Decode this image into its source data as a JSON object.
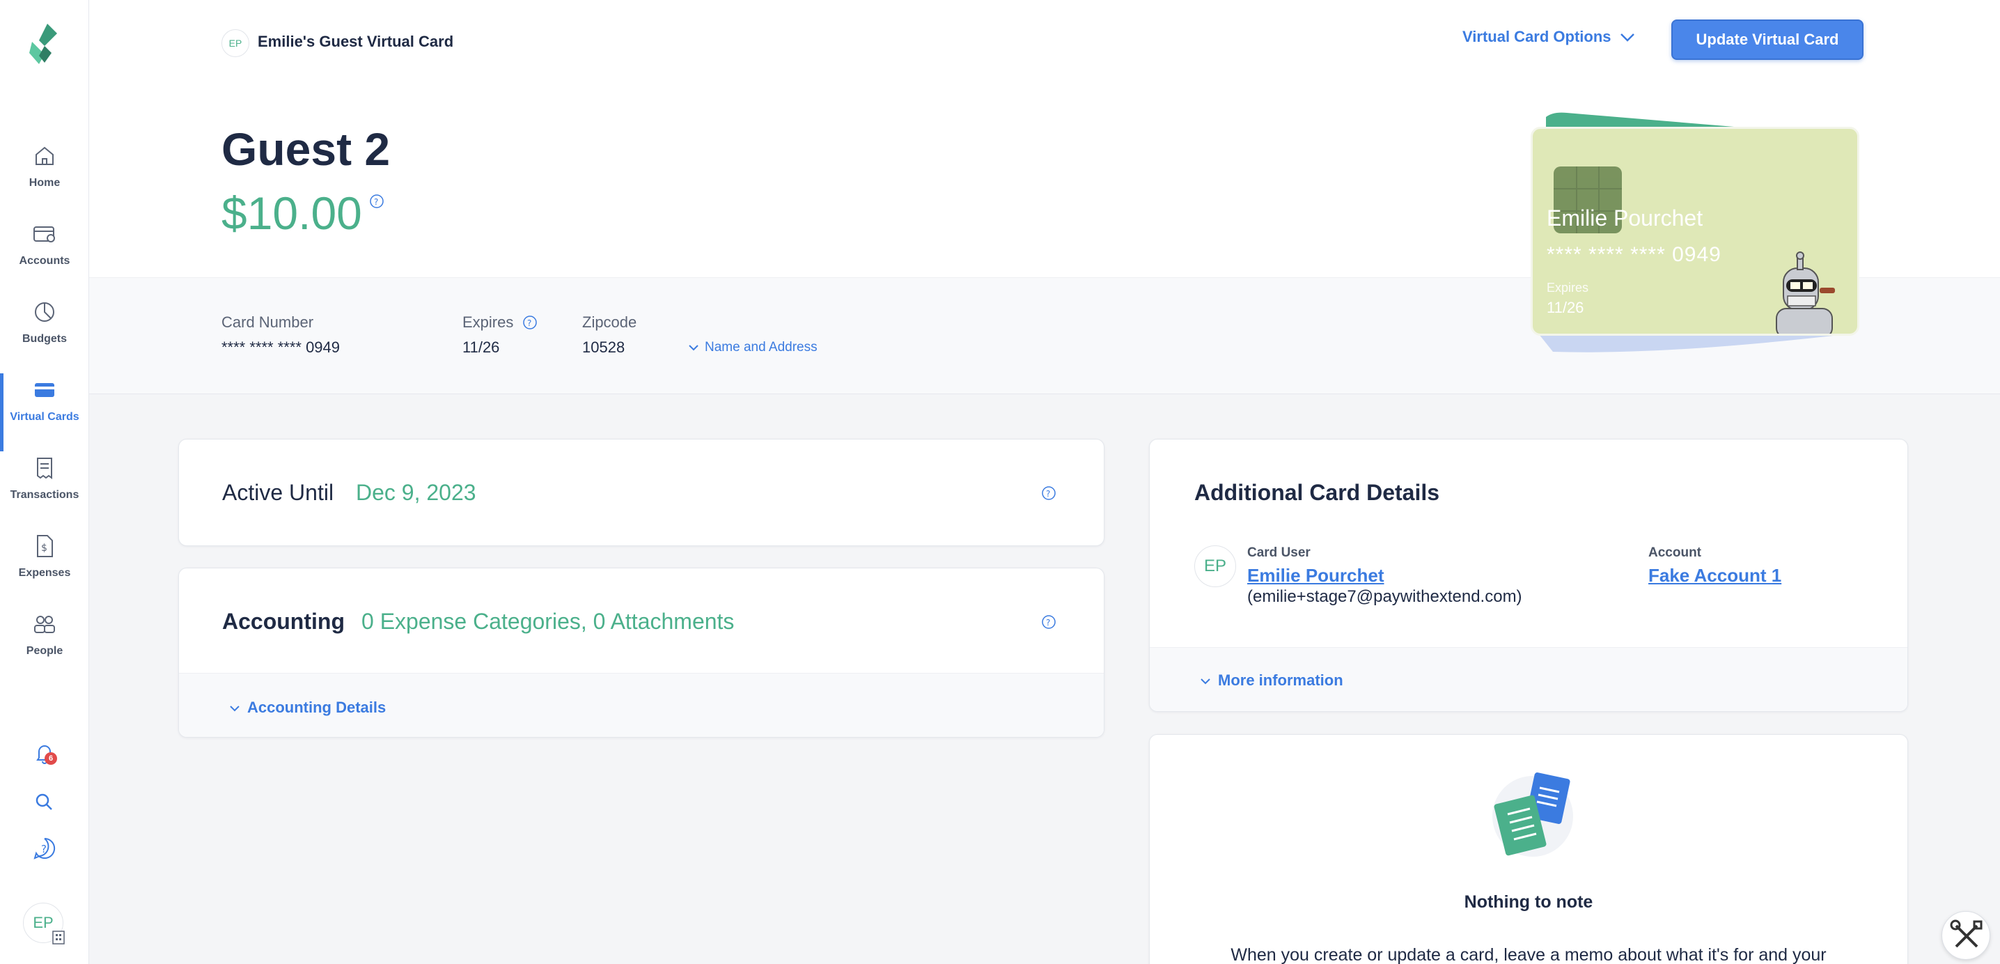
{
  "sidebar": {
    "items": [
      {
        "label": "Home",
        "icon": "home-icon"
      },
      {
        "label": "Accounts",
        "icon": "accounts-icon"
      },
      {
        "label": "Budgets",
        "icon": "budgets-icon"
      },
      {
        "label": "Virtual Cards",
        "icon": "virtual-cards-icon",
        "active": true
      },
      {
        "label": "Transactions",
        "icon": "transactions-icon"
      },
      {
        "label": "Expenses",
        "icon": "expenses-icon"
      },
      {
        "label": "People",
        "icon": "people-icon"
      }
    ],
    "notification_count": "6",
    "user_initials": "EP"
  },
  "header": {
    "owner_initials": "EP",
    "card_title": "Emilie's Guest Virtual Card",
    "options_label": "Virtual Card Options",
    "update_label": "Update Virtual Card",
    "card_name": "Guest 2",
    "amount": "$10.00"
  },
  "details": {
    "card_number_label": "Card Number",
    "card_number": "**** **** **** 0949",
    "expires_label": "Expires",
    "expires": "11/26",
    "zipcode_label": "Zipcode",
    "zipcode": "10528",
    "name_address_label": "Name and Address"
  },
  "card_art": {
    "holder": "Emilie Pourchet",
    "number": "**** **** **** 0949",
    "expires_label": "Expires",
    "expires": "11/26",
    "color": "#dfe8b7"
  },
  "active_panel": {
    "label": "Active Until",
    "value": "Dec 9, 2023"
  },
  "accounting_panel": {
    "label": "Accounting",
    "value": "0 Expense Categories, 0 Attachments",
    "details_label": "Accounting Details"
  },
  "additional_panel": {
    "title": "Additional Card Details",
    "user_initials": "EP",
    "card_user_label": "Card User",
    "card_user_name": "Emilie Pourchet",
    "card_user_email": "(emilie+stage7@paywithextend.com)",
    "account_label": "Account",
    "account_name": "Fake Account 1",
    "more_info_label": "More information"
  },
  "notes_panel": {
    "title": "Nothing to note",
    "text": "When you create or update a card, leave a memo about what it's for and your"
  },
  "colors": {
    "accent": "#3b7be0",
    "green": "#4bb08b",
    "navy": "#1f2a44"
  }
}
